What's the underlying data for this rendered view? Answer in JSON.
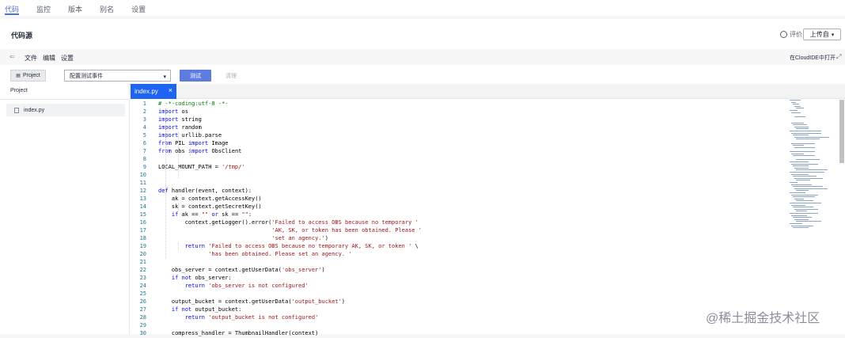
{
  "nav": {
    "tabs": [
      {
        "label": "代码",
        "active": true
      },
      {
        "label": "监控",
        "active": false
      },
      {
        "label": "版本",
        "active": false
      },
      {
        "label": "别名",
        "active": false
      },
      {
        "label": "设置",
        "active": false
      }
    ]
  },
  "header": {
    "title": "代码源",
    "rate_label": "评价",
    "upload_label": "上传自"
  },
  "menu": {
    "items": [
      "文件",
      "编辑",
      "设置"
    ],
    "open_cloud_ide": "在CloudIDE中打开"
  },
  "toolbar": {
    "project_label": "Project",
    "event_select_value": "配置测试事件",
    "test_label": "测试",
    "clear_label": "清理"
  },
  "sidebar": {
    "header": "Project",
    "file": "index.py"
  },
  "editor": {
    "tab_label": "index.py",
    "lines": [
      {
        "n": "1",
        "html": "<span class=\"cm\"># -*-coding:utf-8 -*-</span>"
      },
      {
        "n": "2",
        "html": "<span class=\"kw\">import</span> os"
      },
      {
        "n": "3",
        "html": "<span class=\"kw\">import</span> string"
      },
      {
        "n": "4",
        "html": "<span class=\"kw\">import</span> random"
      },
      {
        "n": "5",
        "html": "<span class=\"kw\">import</span> urllib.parse"
      },
      {
        "n": "6",
        "html": "<span class=\"kw\">from</span> PIL <span class=\"kw\">import</span> Image"
      },
      {
        "n": "7",
        "html": "<span class=\"kw\">from</span> obs <span class=\"kw\">import</span> ObsClient"
      },
      {
        "n": "8",
        "html": ""
      },
      {
        "n": "9",
        "html": "LOCAL_MOUNT_PATH = <span class=\"str\">'/tmp/'</span>"
      },
      {
        "n": "10",
        "html": ""
      },
      {
        "n": "11",
        "html": ""
      },
      {
        "n": "12",
        "html": "<span class=\"kw\">def</span> handler(event, context):"
      },
      {
        "n": "13",
        "html": "    ak = context.getAccessKey()"
      },
      {
        "n": "14",
        "html": "    sk = context.getSecretKey()"
      },
      {
        "n": "15",
        "html": "    <span class=\"kw\">if</span> ak == <span class=\"str\">\"\"</span> <span class=\"kw\">or</span> sk == <span class=\"str\">\"\"</span>:"
      },
      {
        "n": "16",
        "html": "        context.getLogger().error(<span class=\"str\">'Failed to access OBS because no temporary '</span>"
      },
      {
        "n": "17",
        "html": "                                  <span class=\"str\">'AK, SK, or token has been obtained. Please '</span>"
      },
      {
        "n": "18",
        "html": "                                  <span class=\"str\">'set an agency.'</span>)"
      },
      {
        "n": "19",
        "html": "        <span class=\"kw\">return</span> <span class=\"str\">'Failed to access OBS because no temporary AK, SK, or token '</span> \\"
      },
      {
        "n": "20",
        "html": "               <span class=\"str\">'has been obtained. Please set an agency. '</span>"
      },
      {
        "n": "21",
        "html": ""
      },
      {
        "n": "22",
        "html": "    obs_server = context.getUserData(<span class=\"str\">'obs_server'</span>)"
      },
      {
        "n": "23",
        "html": "    <span class=\"kw\">if not</span> obs_server:"
      },
      {
        "n": "24",
        "html": "        <span class=\"kw\">return</span> <span class=\"str\">'obs_server is not configured'</span>"
      },
      {
        "n": "25",
        "html": ""
      },
      {
        "n": "26",
        "html": "    output_bucket = context.getUserData(<span class=\"str\">'output_bucket'</span>)"
      },
      {
        "n": "27",
        "html": "    <span class=\"kw\">if not</span> output_bucket:"
      },
      {
        "n": "28",
        "html": "        <span class=\"kw\">return</span> <span class=\"str\">'output_bucket is not configured'</span>"
      },
      {
        "n": "29",
        "html": ""
      },
      {
        "n": "30",
        "html": "    compress_handler = ThumbnailHandler(context)"
      }
    ]
  },
  "watermark": "@稀土掘金技术社区"
}
